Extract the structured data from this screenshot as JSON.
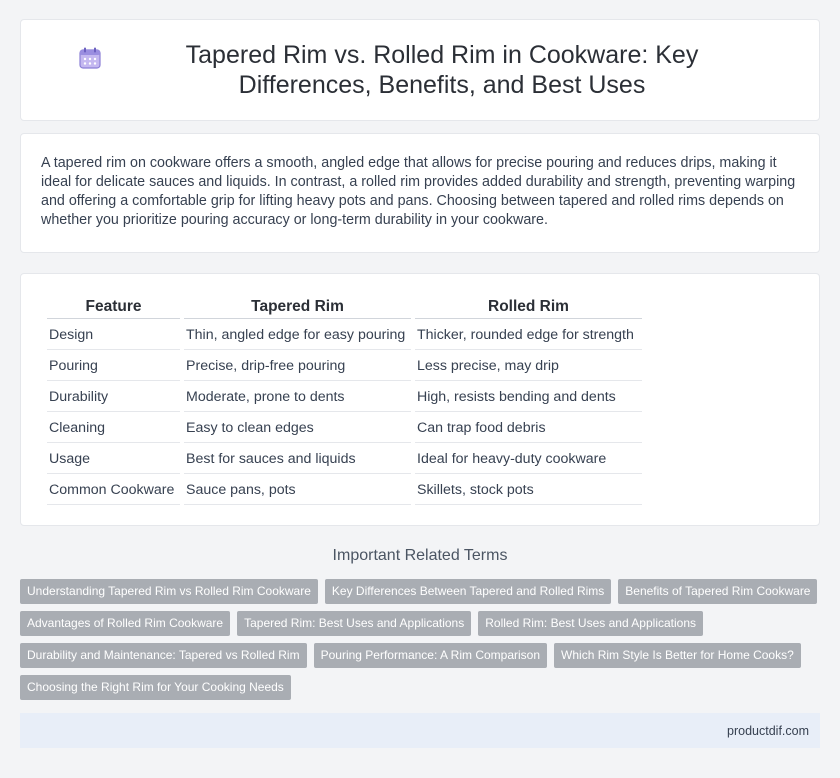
{
  "header": {
    "title": "Tapered Rim vs. Rolled Rim in Cookware: Key Differences, Benefits, and Best Uses",
    "icon": "calendar-icon"
  },
  "intro": {
    "text": "A tapered rim on cookware offers a smooth, angled edge that allows for precise pouring and reduces drips, making it ideal for delicate sauces and liquids. In contrast, a rolled rim provides added durability and strength, preventing warping and offering a comfortable grip for lifting heavy pots and pans. Choosing between tapered and rolled rims depends on whether you prioritize pouring accuracy or long-term durability in your cookware."
  },
  "table": {
    "headers": [
      "Feature",
      "Tapered Rim",
      "Rolled Rim"
    ],
    "rows": [
      [
        "Design",
        "Thin, angled edge for easy pouring",
        "Thicker, rounded edge for strength"
      ],
      [
        "Pouring",
        "Precise, drip-free pouring",
        "Less precise, may drip"
      ],
      [
        "Durability",
        "Moderate, prone to dents",
        "High, resists bending and dents"
      ],
      [
        "Cleaning",
        "Easy to clean edges",
        "Can trap food debris"
      ],
      [
        "Usage",
        "Best for sauces and liquids",
        "Ideal for heavy-duty cookware"
      ],
      [
        "Common Cookware",
        "Sauce pans, pots",
        "Skillets, stock pots"
      ]
    ]
  },
  "related": {
    "heading": "Important Related Terms",
    "tags": [
      "Understanding Tapered Rim vs Rolled Rim Cookware",
      "Key Differences Between Tapered and Rolled Rims",
      "Benefits of Tapered Rim Cookware",
      "Advantages of Rolled Rim Cookware",
      "Tapered Rim: Best Uses and Applications",
      "Rolled Rim: Best Uses and Applications",
      "Durability and Maintenance: Tapered vs Rolled Rim",
      "Pouring Performance: A Rim Comparison",
      "Which Rim Style Is Better for Home Cooks?",
      "Choosing the Right Rim for Your Cooking Needs"
    ]
  },
  "footer": {
    "site": "productdif.com"
  },
  "colors": {
    "background": "#f3f4f6",
    "tag_bg": "#a9adb3",
    "footer_bg": "#e8eef8",
    "icon_accent": "#8b7fd6"
  }
}
